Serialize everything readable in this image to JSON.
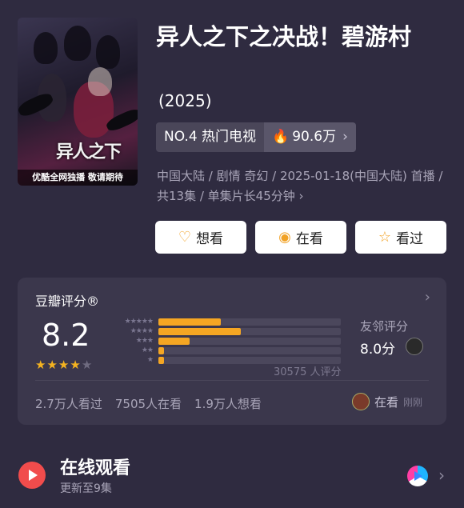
{
  "title": "异人之下之决战！碧游村",
  "year": "(2025)",
  "poster": {
    "logo_text": "异人之下",
    "badge": "优酷全网独播 敬请期待"
  },
  "rank": {
    "label": "NO.4 热门电视",
    "heat": "90.6万",
    "heat_icon": "flame-icon"
  },
  "meta": "中国大陆 / 剧情 奇幻 / 2025-01-18(中国大陆) 首播 / 共13集 / 单集片长45分钟",
  "actions": [
    {
      "label": "想看",
      "icon": "heart-plus-icon"
    },
    {
      "label": "在看",
      "icon": "target-icon"
    },
    {
      "label": "看过",
      "icon": "star-icon"
    }
  ],
  "rating": {
    "title": "豆瓣评分®",
    "score": "8.2",
    "stars_filled": 4,
    "stars_total": 5,
    "distribution": [
      {
        "stars": "★★★★★",
        "fraction": 0.34
      },
      {
        "stars": "★★★★",
        "fraction": 0.45
      },
      {
        "stars": "★★★",
        "fraction": 0.17
      },
      {
        "stars": "★★",
        "fraction": 0.03
      },
      {
        "stars": "★",
        "fraction": 0.03
      }
    ],
    "count": "30575 人评分",
    "friend_label": "友邻评分",
    "friend_score": "8.0分",
    "stats": [
      "2.7万人看过",
      "7505人在看",
      "1.9万人想看"
    ],
    "watching_label": "在看",
    "watching_time": "刚刚"
  },
  "online": {
    "title": "在线观看",
    "subtitle": "更新至9集"
  },
  "colors": {
    "background": "#2f2b40",
    "card": "#3b374c",
    "accent": "#f5a623"
  }
}
